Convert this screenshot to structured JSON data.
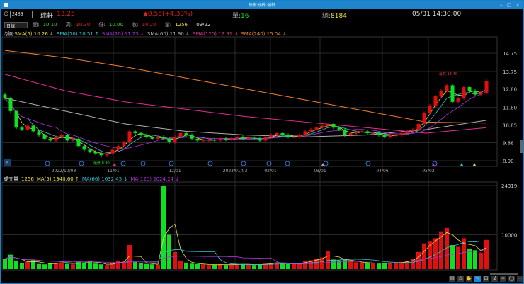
{
  "window": {
    "title": "技術分析-瑞軒",
    "controls": [
      "–",
      "▢",
      "×"
    ]
  },
  "quote": {
    "code": "2489",
    "name": "瑞軒",
    "price": "13.25",
    "change": "▲0.55(+4.33%)",
    "single_label": "單:",
    "single": "16",
    "total_label": "總:",
    "total": "8184",
    "datetime": "05/31 14:30:00"
  },
  "ohlc": {
    "period": "日線",
    "open_label": "開:",
    "open": "10.10",
    "high_label": "高:",
    "high": "10.30",
    "low_label": "低:",
    "low": "10.00",
    "close_label": "收:",
    "close": "10.20",
    "vol_label": "量:",
    "vol": "1256",
    "date": "09/22"
  },
  "ma_legend": {
    "prefix": "均線:",
    "items": [
      {
        "text": "SMA(5) 10.26 ↓",
        "color": "#e8e040"
      },
      {
        "text": "SMA(10) 10.51 ↑",
        "color": "#30c8d8"
      },
      {
        "text": "SMA(20) 11.23 ↓",
        "color": "#b030e0"
      },
      {
        "text": "SMA(60) 11.90 ↓",
        "color": "#b0b0b0"
      },
      {
        "text": "SMA(120) 12.91 ↓",
        "color": "#e03090"
      },
      {
        "text": "SMA(240) 15.04 ↓",
        "color": "#f08030"
      }
    ]
  },
  "volume_legend": {
    "prefix": "成交量",
    "value": "1256",
    "items": [
      {
        "text": "MA(5) 1348.60 ↑",
        "color": "#e8e040"
      },
      {
        "text": "MA(66) 1632.45 ↓",
        "color": "#30c8d8"
      },
      {
        "text": "MA(120) 2024.24 ↓",
        "color": "#b030e0"
      }
    ]
  },
  "chart_data": {
    "type": "candlestick",
    "price_ticks": [
      "14.75",
      "13.75",
      "12.80",
      "11.80",
      "10.85",
      "9.88",
      "8.90"
    ],
    "price_range": [
      8.9,
      14.75
    ],
    "volume_ticks": [
      "24319",
      "10000"
    ],
    "volume_range": [
      0,
      24319
    ],
    "date_labels": [
      "2022/10/03",
      "11/01",
      "12/01",
      "2023/01/03",
      "02/01",
      "03/01",
      "04/06",
      "05/02"
    ],
    "annotations": {
      "high": "最高 13.40",
      "low": "最低 8.90"
    },
    "close": [
      12.3,
      11.6,
      10.7,
      10.6,
      10.8,
      10.5,
      10.3,
      10.1,
      10.0,
      10.2,
      10.3,
      10.0,
      10.1,
      9.7,
      9.5,
      9.4,
      9.3,
      9.2,
      9.3,
      9.5,
      9.7,
      9.9,
      10.5,
      10.4,
      10.3,
      10.2,
      10.1,
      10.2,
      10.1,
      9.9,
      10.2,
      10.4,
      10.3,
      10.1,
      10.0,
      10.0,
      10.05,
      10.0,
      10.1,
      10.05,
      10.1,
      10.2,
      10.1,
      10.15,
      10.1,
      10.0,
      10.2,
      10.3,
      10.4,
      10.3,
      10.2,
      10.2,
      10.3,
      10.5,
      10.6,
      10.7,
      10.8,
      10.9,
      10.7,
      10.6,
      10.3,
      10.4,
      10.5,
      10.5,
      10.4,
      10.4,
      10.3,
      10.2,
      10.3,
      10.3,
      10.4,
      10.5,
      10.6,
      10.9,
      11.5,
      11.9,
      12.4,
      12.7,
      13.0,
      12.1,
      12.3,
      12.9,
      12.7,
      12.5,
      12.6,
      13.25
    ],
    "volume": [
      3000,
      4200,
      2500,
      1800,
      2200,
      2600,
      1500,
      1400,
      1800,
      1600,
      2000,
      1500,
      1400,
      2200,
      1900,
      2500,
      1600,
      1400,
      1200,
      1800,
      2500,
      2000,
      7000,
      2200,
      1800,
      1500,
      1400,
      1300,
      24319,
      10000,
      5000,
      2500,
      1900,
      1600,
      1500,
      1400,
      1200,
      1300,
      1400,
      1200,
      1300,
      1500,
      1400,
      1300,
      1200,
      1400,
      1600,
      1800,
      2000,
      1700,
      1600,
      1500,
      1700,
      2400,
      2600,
      3000,
      3400,
      5200,
      2800,
      2600,
      3000,
      2200,
      2000,
      1900,
      1800,
      1700,
      1600,
      1800,
      1700,
      1900,
      2100,
      2400,
      3000,
      5000,
      7500,
      8200,
      9000,
      11000,
      12000,
      7000,
      6500,
      9000,
      6000,
      5500,
      4800,
      8500
    ],
    "long_ma": [
      {
        "name": "SMA(60)",
        "color": "#b0b0b0",
        "values": [
          12.3,
          11.6,
          10.9,
          10.5,
          10.3,
          10.2,
          10.3,
          10.6,
          11.1
        ]
      },
      {
        "name": "SMA(120)",
        "color": "#e03090",
        "values": [
          13.6,
          12.7,
          12.1,
          11.7,
          11.3,
          11.0,
          10.7,
          10.4,
          10.7
        ]
      },
      {
        "name": "SMA(240)",
        "color": "#f08030",
        "values": [
          14.9,
          14.5,
          14.0,
          13.4,
          12.8,
          12.2,
          11.6,
          11.0,
          10.95
        ]
      }
    ]
  },
  "colors": {
    "up": "#e01010",
    "down": "#10e020",
    "grid": "#2a2a2a",
    "accent": "#1d86cf"
  },
  "toolbar": [
    "▤",
    "⎙",
    "✋",
    "↖",
    "⊞",
    "⊻",
    "∞",
    "◯",
    "−",
    "+"
  ]
}
